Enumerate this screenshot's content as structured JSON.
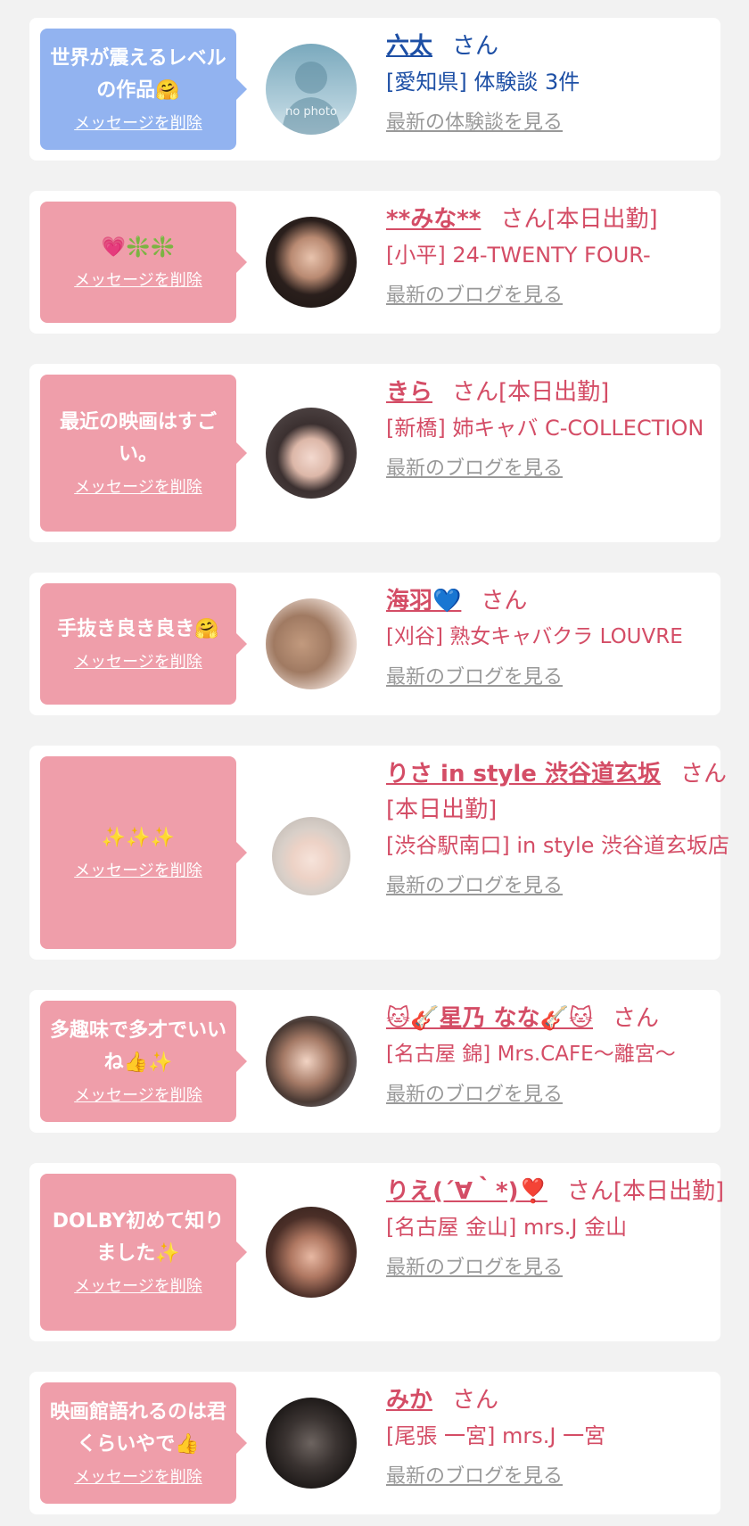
{
  "colors": {
    "blue_bubble": "#92b3f0",
    "pink_bubble": "#ef9eaa",
    "blue_text": "#1d4fa5",
    "pink_text": "#d44d66",
    "link_gray": "#999999"
  },
  "delete_label": "メッセージを削除",
  "san": "さん",
  "items": [
    {
      "message": "世界が震えるレベルの作品",
      "message_emoji": "🤗",
      "name": "六太",
      "status": "",
      "shop": "[愛知県] 体験談 3件",
      "latest": "最新の体験談を見る",
      "avatar": "no photo"
    },
    {
      "message": "",
      "message_emoji": "💗❇️❇️",
      "name": "**みな**",
      "status": "[本日出勤]",
      "shop": "[小平] 24-TWENTY FOUR-",
      "latest": "最新のブログを見る",
      "avatar": "photo"
    },
    {
      "message": "最近の映画はすごい。",
      "message_emoji": "",
      "name": "きら",
      "status": "[本日出勤]",
      "shop": "[新橋] 姉キャバ C-COLLECTION",
      "latest": "最新のブログを見る",
      "avatar": "photo"
    },
    {
      "message": "手抜き良き良き",
      "message_emoji": "🤗",
      "name": "海羽💙",
      "status": "",
      "shop": "[刈谷] 熟女キャバクラ LOUVRE",
      "latest": "最新のブログを見る",
      "avatar": "photo"
    },
    {
      "message": "",
      "message_emoji": "✨✨✨",
      "name": "りさ in style 渋谷道玄坂",
      "status": "[本日出勤]",
      "shop": "[渋谷駅南口] in style 渋谷道玄坂店",
      "latest": "最新のブログを見る",
      "avatar": "photo"
    },
    {
      "message": "多趣味で多才でいいね",
      "message_emoji": "👍✨",
      "name": "🐱🎸星乃 なな🎸🐱",
      "status": "",
      "shop": "[名古屋 錦] Mrs.CAFE〜離宮〜",
      "latest": "最新のブログを見る",
      "avatar": "photo"
    },
    {
      "message": "DOLBY初めて知りました",
      "message_emoji": "✨",
      "name": "りえ(´∀｀*)❣️",
      "status": "[本日出勤]",
      "shop": "[名古屋 金山] mrs.J 金山",
      "latest": "最新のブログを見る",
      "avatar": "photo"
    },
    {
      "message": "映画館語れるのは君くらいやで",
      "message_emoji": "👍",
      "name": "みか",
      "status": "",
      "shop": "[尾張 一宮] mrs.J 一宮",
      "latest": "最新のブログを見る",
      "avatar": "photo"
    }
  ]
}
